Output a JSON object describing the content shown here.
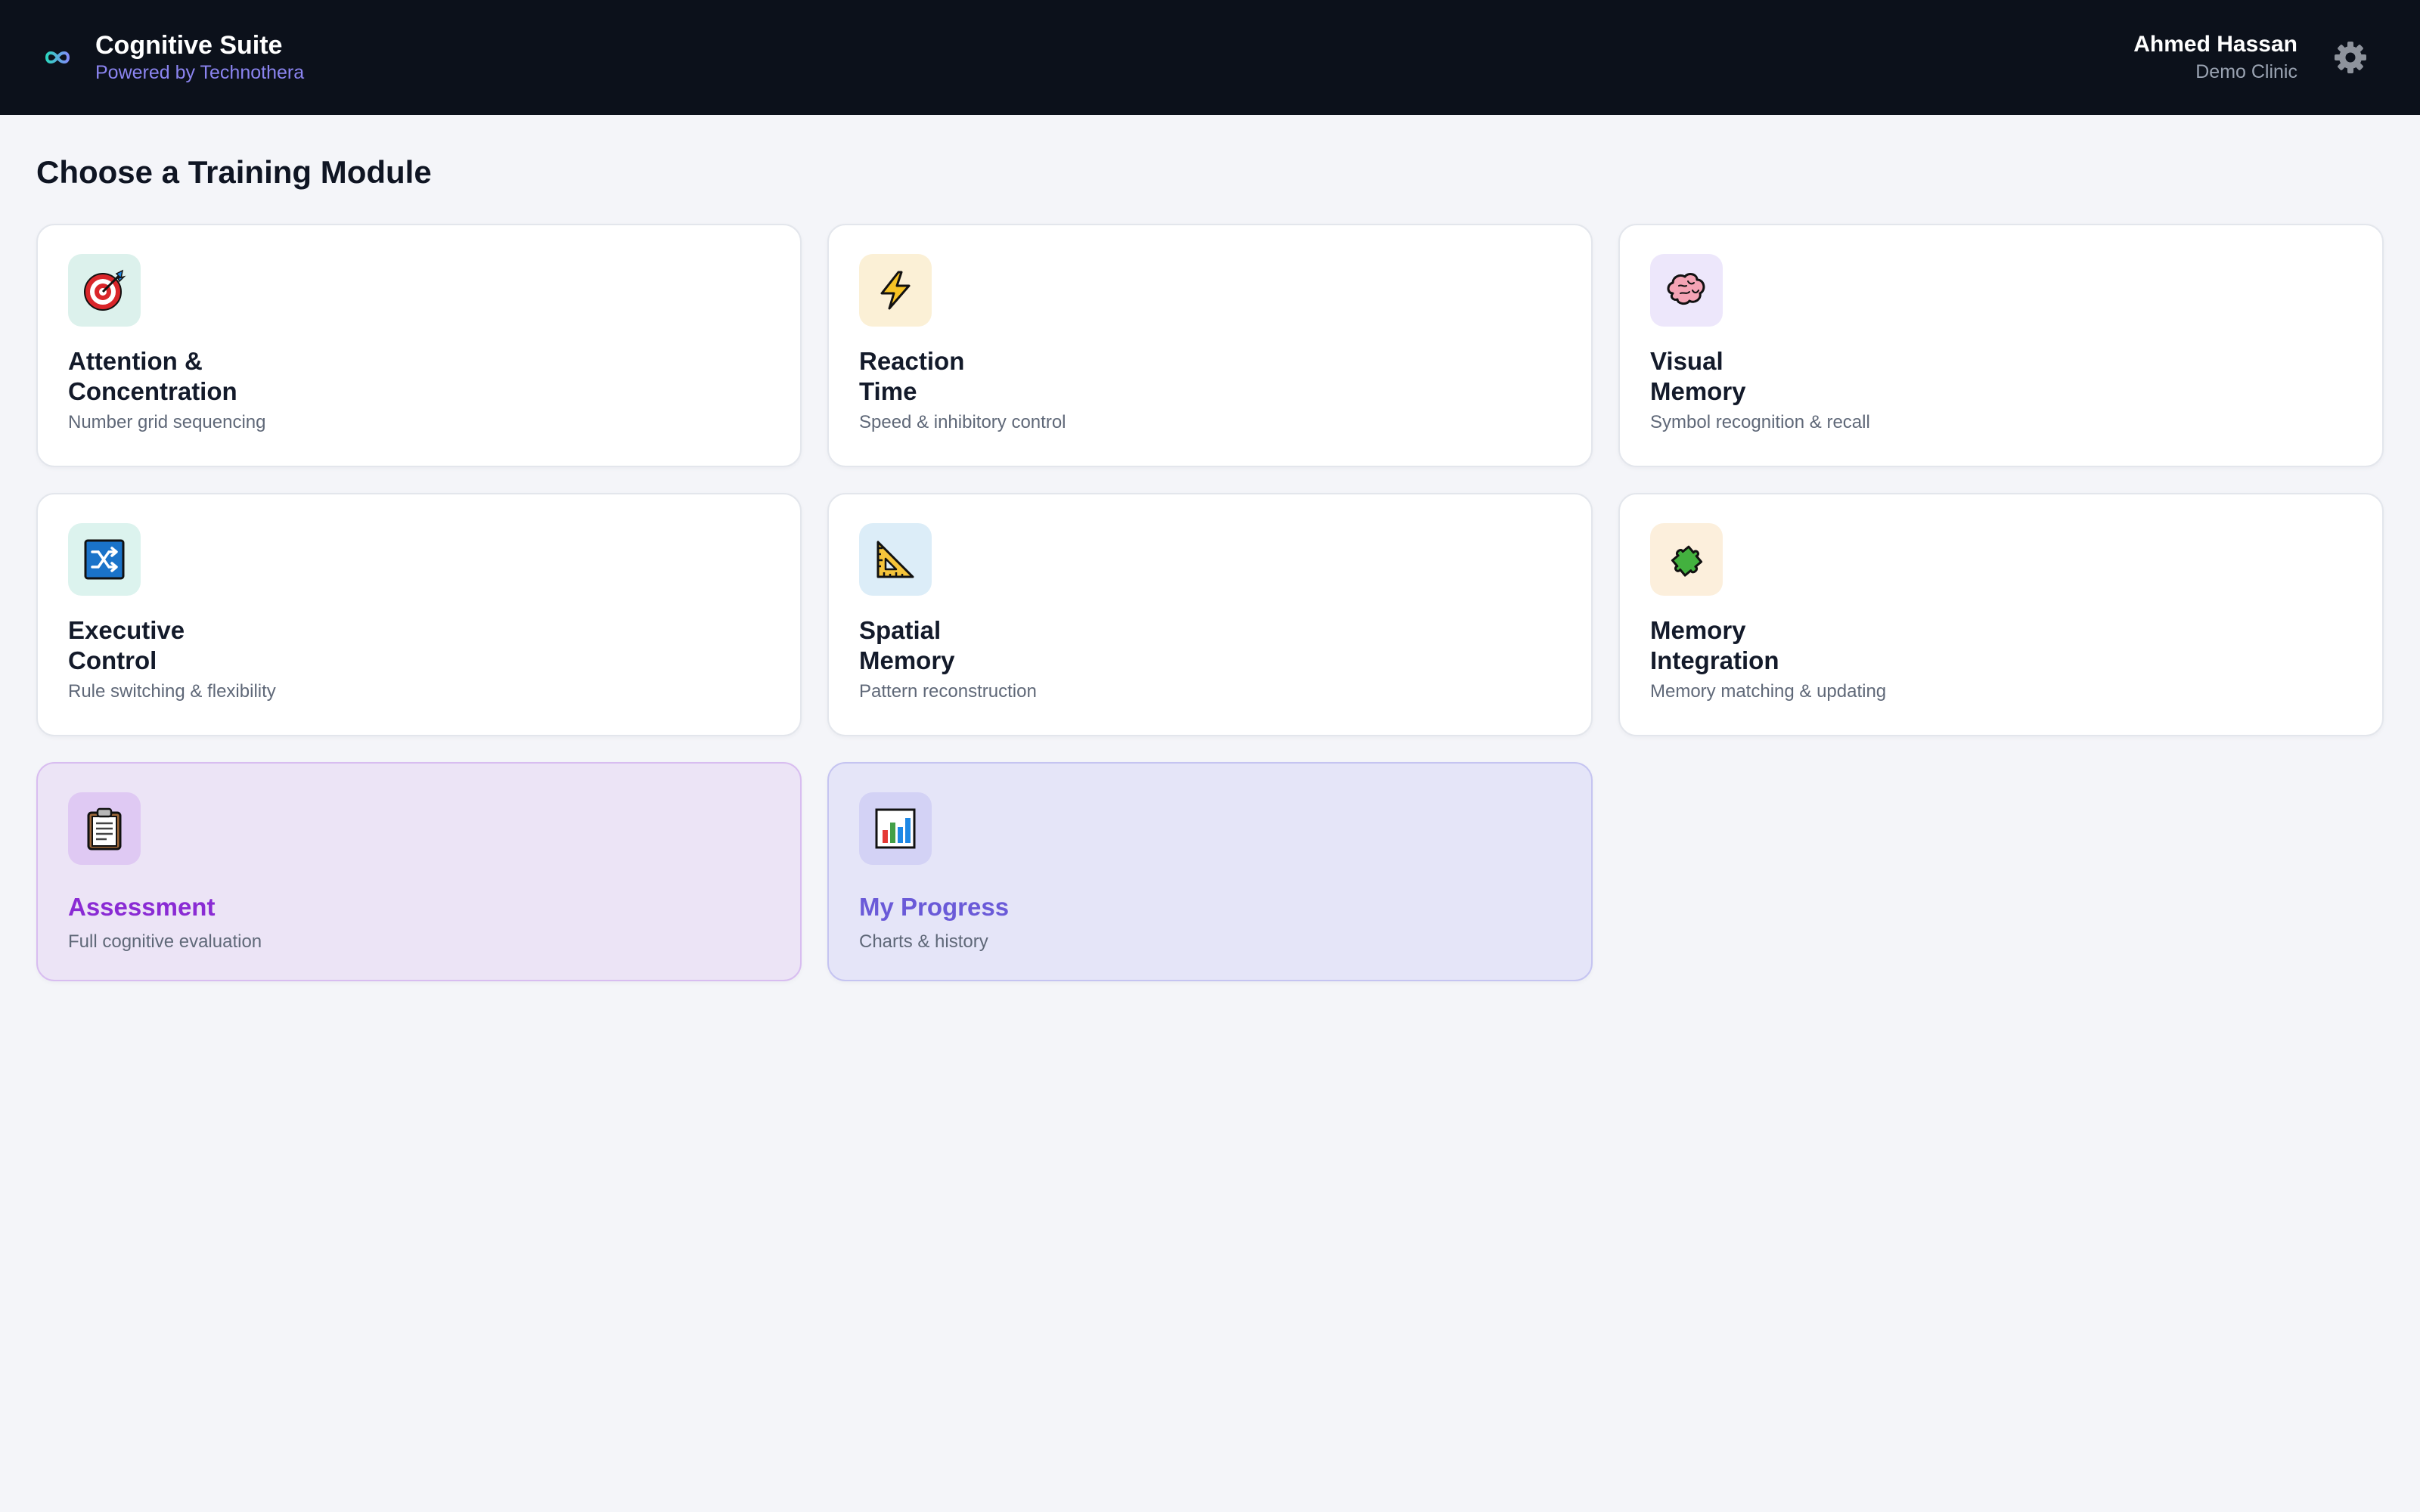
{
  "header": {
    "app_title": "Cognitive Suite",
    "app_subtitle": "Powered by Technothera",
    "user_name": "Ahmed Hassan",
    "user_org": "Demo Clinic",
    "logo_icon": "infinity-logo-icon",
    "settings_icon": "gear-icon"
  },
  "main": {
    "page_title": "Choose a Training Module",
    "modules": [
      {
        "title": "Attention &\nConcentration",
        "description": "Number grid sequencing",
        "icon": "target-icon",
        "icon_bg": "#dcf1ec"
      },
      {
        "title": "Reaction\nTime",
        "description": "Speed & inhibitory control",
        "icon": "lightning-icon",
        "icon_bg": "#fbf0d6"
      },
      {
        "title": "Visual\nMemory",
        "description": "Symbol recognition & recall",
        "icon": "brain-icon",
        "icon_bg": "#ede7fb"
      },
      {
        "title": "Executive\nControl",
        "description": "Rule switching & flexibility",
        "icon": "shuffle-icon",
        "icon_bg": "#dcf3ee"
      },
      {
        "title": "Spatial\nMemory",
        "description": "Pattern reconstruction",
        "icon": "triangular-ruler-icon",
        "icon_bg": "#dcedf8"
      },
      {
        "title": "Memory\nIntegration",
        "description": "Memory matching & updating",
        "icon": "puzzle-icon",
        "icon_bg": "#fcefdc"
      }
    ],
    "assessment": {
      "title": "Assessment",
      "description": "Full cognitive evaluation",
      "icon": "clipboard-icon",
      "icon_bg": "#dfc9f3"
    },
    "progress": {
      "title": "My Progress",
      "description": "Charts & history",
      "icon": "bar-chart-icon",
      "icon_bg": "#d3d2f5"
    }
  },
  "colors": {
    "header_bg": "#0c111b",
    "page_bg": "#f4f5f9",
    "accent_subtitle": "#8b84f0",
    "assessment_title": "#8a2bd4",
    "progress_title": "#6a5ad8"
  }
}
